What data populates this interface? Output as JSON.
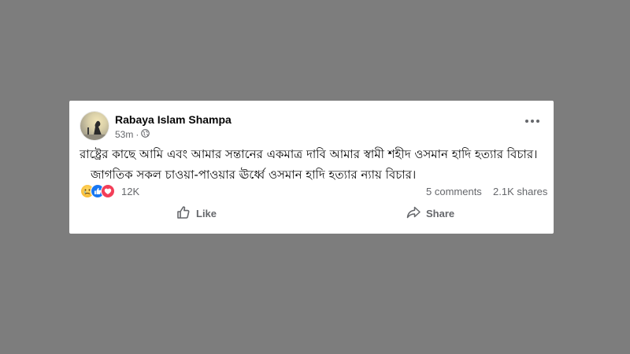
{
  "post": {
    "author": "Rabaya Islam Shampa",
    "time": "53m",
    "separator": "·",
    "privacy_icon": "globe-icon",
    "more_icon": "more-options-icon",
    "body_line1": "রাষ্ট্রের কাছে আমি এবং আমার সন্তানের একমাত্র দাবি আমার স্বামী শহীদ ওসমান হাদি হত্যার বিচার।",
    "body_line2": "জাগতিক সকল চাওয়া-পাওয়ার ঊর্ধ্বে ওসমান হাদি হত্যার ন্যায় বিচার।"
  },
  "stats": {
    "reaction_icons": [
      "sad-reaction-icon",
      "like-reaction-icon",
      "love-reaction-icon"
    ],
    "reaction_count": "12K",
    "comments": "5 comments",
    "shares": "2.1K shares"
  },
  "actions": {
    "like_label": "Like",
    "share_label": "Share"
  },
  "colors": {
    "background": "#7d7d7d",
    "card": "#ffffff",
    "text_primary": "#050505",
    "text_secondary": "#65676b",
    "like_blue": "#1877f2",
    "love_red": "#f33e58"
  }
}
